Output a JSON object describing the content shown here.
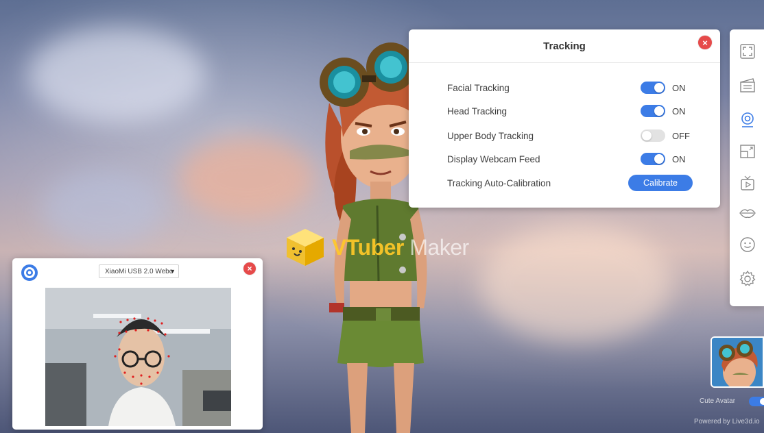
{
  "tracking_panel": {
    "title": "Tracking",
    "rows": [
      {
        "label": "Facial Tracking",
        "state": "ON"
      },
      {
        "label": "Head Tracking",
        "state": "ON"
      },
      {
        "label": "Upper Body Tracking",
        "state": "OFF"
      },
      {
        "label": "Display Webcam Feed",
        "state": "ON"
      },
      {
        "label": "Tracking Auto-Calibration",
        "button": "Calibrate"
      }
    ]
  },
  "toolbar": {
    "icons": [
      "fullscreen-icon",
      "clapperboard-icon",
      "webcam-icon",
      "layout-icon",
      "tv-icon",
      "lips-icon",
      "smiley-icon",
      "gear-icon"
    ]
  },
  "webcam_panel": {
    "device": "XiaoMi USB 2.0 Webc"
  },
  "watermark": {
    "brand_a": "VTuber",
    "brand_b": " Maker"
  },
  "avatar_switcher": {
    "label": "Cute Avatar",
    "toggle": true
  },
  "footer": {
    "powered_by": "Powered by Live3d.io"
  },
  "colors": {
    "accent": "#3c7ce6",
    "close": "#e64a4a",
    "toggle_off": "#e2e2e2"
  }
}
